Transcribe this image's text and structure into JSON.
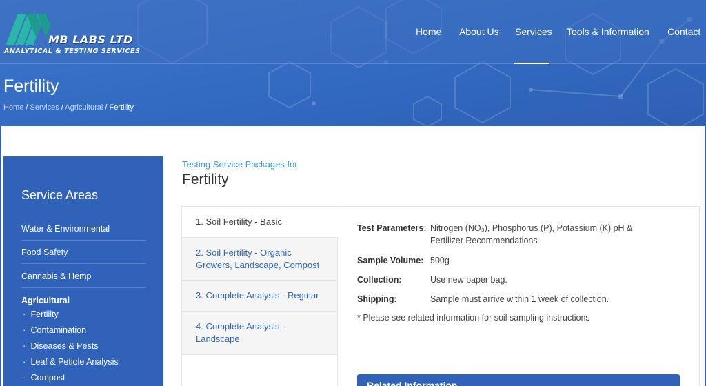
{
  "brand": {
    "name": "MB LABS LTD",
    "tagline": "ANALYTICAL & TESTING SERVICES"
  },
  "nav": {
    "items": [
      "Home",
      "About Us",
      "Services",
      "Tools & Information",
      "Contact"
    ],
    "active": "Services"
  },
  "page": {
    "title": "Fertility",
    "breadcrumb": [
      "Home",
      "Services",
      "Agricultural",
      "Fertility"
    ],
    "breadcrumb_sep": " / "
  },
  "sidebar": {
    "title": "Service Areas",
    "links": [
      "Water & Environmental",
      "Food Safety",
      "Cannabis & Hemp"
    ],
    "active_section": "Agricultural",
    "sub_items": [
      "Fertility",
      "Contamination",
      "Diseases & Pests",
      "Leaf & Petiole Analysis",
      "Compost"
    ],
    "bullet": "·"
  },
  "main": {
    "kicker": "Testing Service Packages for",
    "title": "Fertility"
  },
  "tabs": [
    "1. Soil Fertility - Basic",
    "2. Soil Fertility - Organic Growers, Landscape, Compost",
    "3. Complete Analysis - Regular",
    "4. Complete Analysis - Landscape"
  ],
  "active_tab": 0,
  "details": {
    "rows": [
      {
        "label": "Test Parameters:",
        "value": "Nitrogen (NO₃), Phosphorus (P), Potassium (K) pH & Fertilizer Recommendations"
      },
      {
        "label": "Sample Volume:",
        "value": "500g"
      },
      {
        "label": "Collection:",
        "value": "Use new paper bag."
      },
      {
        "label": "Shipping:",
        "value": "Sample must arrive within 1 week of collection."
      }
    ],
    "note": "* Please see related information for soil sampling instructions"
  },
  "related": {
    "title": "Related Information"
  },
  "colors": {
    "header_blue": "#3a6ec4",
    "sidebar_blue": "#2f62b8",
    "link_blue": "#2f67b5",
    "kicker_blue": "#3a9fd4"
  }
}
